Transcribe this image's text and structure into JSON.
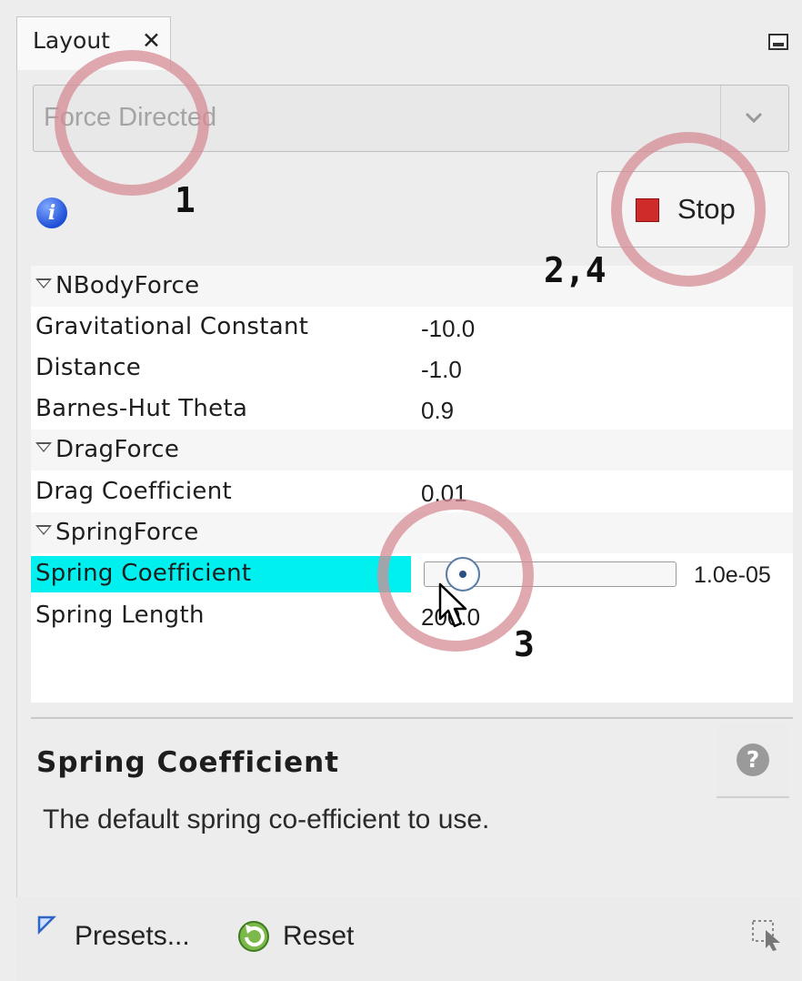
{
  "tab": {
    "title": "Layout",
    "close_glyph": "✕"
  },
  "layout_select": {
    "value": "Force Directed"
  },
  "info_glyph": "i",
  "stop_button": {
    "label": "Stop"
  },
  "properties": {
    "nbody": {
      "category": "NBodyForce",
      "rows": [
        {
          "label": "Gravitational Constant",
          "value": "-10.0"
        },
        {
          "label": "Distance",
          "value": "-1.0"
        },
        {
          "label": "Barnes-Hut Theta",
          "value": "0.9"
        }
      ]
    },
    "drag": {
      "category": "DragForce",
      "rows": [
        {
          "label": "Drag Coefficient",
          "value": "0.01"
        }
      ]
    },
    "spring": {
      "category": "SpringForce",
      "rows": [
        {
          "label": "Spring Coefficient",
          "value": "1.0e-05",
          "slider_fraction": 0.1
        },
        {
          "label": "Spring Length",
          "value": "200.0"
        }
      ]
    }
  },
  "description": {
    "title": "Spring Coefficient",
    "text": "The default spring co-efficient to use.",
    "help_glyph": "?"
  },
  "footer": {
    "presets_label": "Presets...",
    "reset_label": "Reset"
  },
  "annotations": {
    "step_1": "1",
    "step_2_4": "2,4",
    "step_3": "3"
  },
  "colors": {
    "selection": "#00f0f0",
    "stop_square": "#cf2b2b",
    "annotation_ring": "#d68c96",
    "info_icon": "#1f4fd6"
  },
  "icons": [
    "close-icon",
    "minimize-icon",
    "chevron-down-icon",
    "info-icon",
    "stop-icon",
    "expand-triangle-icon",
    "help-icon",
    "presets-icon",
    "reset-icon",
    "grip-icon",
    "mouse-pointer-icon"
  ]
}
